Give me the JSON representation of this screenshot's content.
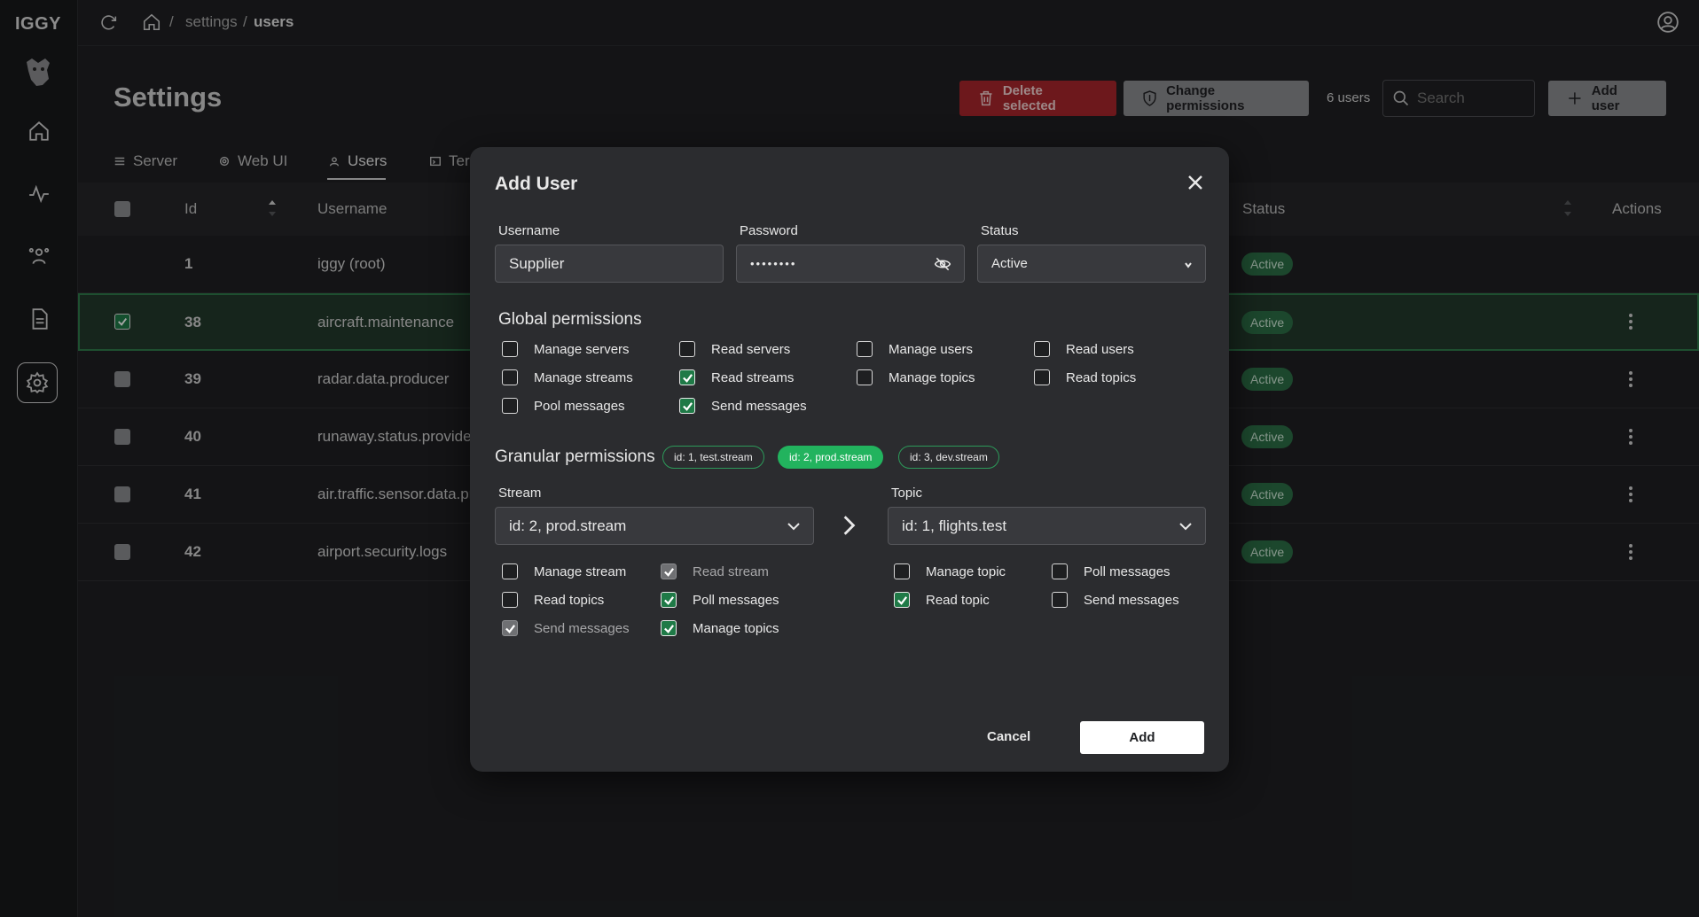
{
  "app": {
    "logo": "IGGY"
  },
  "breadcrumb": {
    "sep1": "/",
    "settings": "settings",
    "sep2": "/",
    "users": "users"
  },
  "page": {
    "title": "Settings"
  },
  "toolbar": {
    "delete_label": "Delete selected",
    "change_permissions_label": "Change permissions",
    "user_count": "6 users",
    "search_placeholder": "Search",
    "add_user_label": "Add user"
  },
  "tabs": [
    {
      "label": "Server",
      "icon": "sliders-icon"
    },
    {
      "label": "Web UI",
      "icon": "gear-icon"
    },
    {
      "label": "Users",
      "icon": "users-icon"
    },
    {
      "label": "Ter",
      "icon": "terminal-icon"
    }
  ],
  "table": {
    "headers": {
      "id": "Id",
      "username": "Username",
      "status": "Status",
      "actions": "Actions"
    },
    "rows": [
      {
        "id": "1",
        "username": "iggy (root)",
        "status": "Active"
      },
      {
        "id": "38",
        "username": "aircraft.maintenance",
        "status": "Active"
      },
      {
        "id": "39",
        "username": "radar.data.producer",
        "status": "Active"
      },
      {
        "id": "40",
        "username": "runaway.status.provider",
        "status": "Active"
      },
      {
        "id": "41",
        "username": "air.traffic.sensor.data.pr",
        "status": "Active"
      },
      {
        "id": "42",
        "username": "airport.security.logs",
        "status": "Active"
      }
    ]
  },
  "modal": {
    "title": "Add User",
    "username_label": "Username",
    "username_value": "Supplier",
    "password_label": "Password",
    "password_value": "••••••••",
    "status_label": "Status",
    "status_value": "Active",
    "global_title": "Global permissions",
    "global": [
      {
        "label": "Manage servers",
        "checked": false
      },
      {
        "label": "Read servers",
        "checked": false
      },
      {
        "label": "Manage users",
        "checked": false
      },
      {
        "label": "Read users",
        "checked": false
      },
      {
        "label": "Manage streams",
        "checked": false
      },
      {
        "label": "Read streams",
        "checked": true
      },
      {
        "label": "Manage topics",
        "checked": false
      },
      {
        "label": "Read topics",
        "checked": false
      },
      {
        "label": "Pool messages",
        "checked": false
      },
      {
        "label": "Send messages",
        "checked": true
      }
    ],
    "granular_title": "Granular permissions",
    "stream_pills": [
      "id: 1, test.stream",
      "id: 2, prod.stream",
      "id: 3, dev.stream"
    ],
    "active_pill": 1,
    "stream_label": "Stream",
    "stream_value": "id: 2, prod.stream",
    "topic_label": "Topic",
    "topic_value": "id: 1, flights.test",
    "stream_perms": [
      {
        "label": "Manage stream",
        "state": "off"
      },
      {
        "label": "Read stream",
        "state": "disabled"
      },
      {
        "label": "Read topics",
        "state": "off"
      },
      {
        "label": "Poll messages",
        "state": "on"
      },
      {
        "label": "Send messages",
        "state": "disabled"
      },
      {
        "label": "Manage topics",
        "state": "on"
      }
    ],
    "topic_perms": [
      {
        "label": "Manage topic",
        "state": "off"
      },
      {
        "label": "Poll messages",
        "state": "off"
      },
      {
        "label": "Read topic",
        "state": "on"
      },
      {
        "label": "Send messages",
        "state": "off"
      }
    ],
    "cancel_label": "Cancel",
    "add_label": "Add"
  },
  "colors": {
    "accent_green": "#22b35e",
    "danger_red": "#b3262b",
    "badge_green": "#2c6e46"
  }
}
